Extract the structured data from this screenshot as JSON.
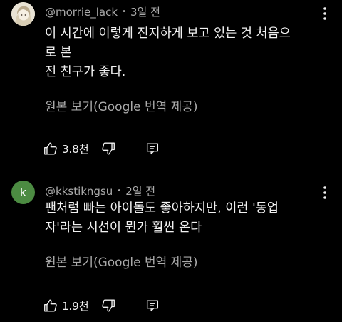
{
  "comments": [
    {
      "author": "@morrie_lack",
      "separator": "•",
      "time": "3일 전",
      "text_lines": [
        "이 시간에 이렇게 진지하게 보고 있는 것 처음으",
        "로 본",
        "전 친구가 좋다."
      ],
      "translate_label": "원본 보기(Google 번역 제공)",
      "likes": "3.8천",
      "avatar_color": "#e8e2d4"
    },
    {
      "author": "@kkstikngsu",
      "separator": "•",
      "time": "2일 전",
      "avatar_letter": "k",
      "text_lines": [
        "팬처럼 빠는 아이돌도 좋아하지만, 이런 '동업",
        "자'라는 시선이 뭔가 훨씬 온다"
      ],
      "translate_label": "원본 보기(Google 번역 제공)",
      "likes": "1.9천",
      "avatar_color": "#4c8b42"
    }
  ],
  "icons": {
    "more": "more-vert-icon",
    "like": "thumb-up-icon",
    "dislike": "thumb-down-icon",
    "reply": "reply-icon"
  }
}
